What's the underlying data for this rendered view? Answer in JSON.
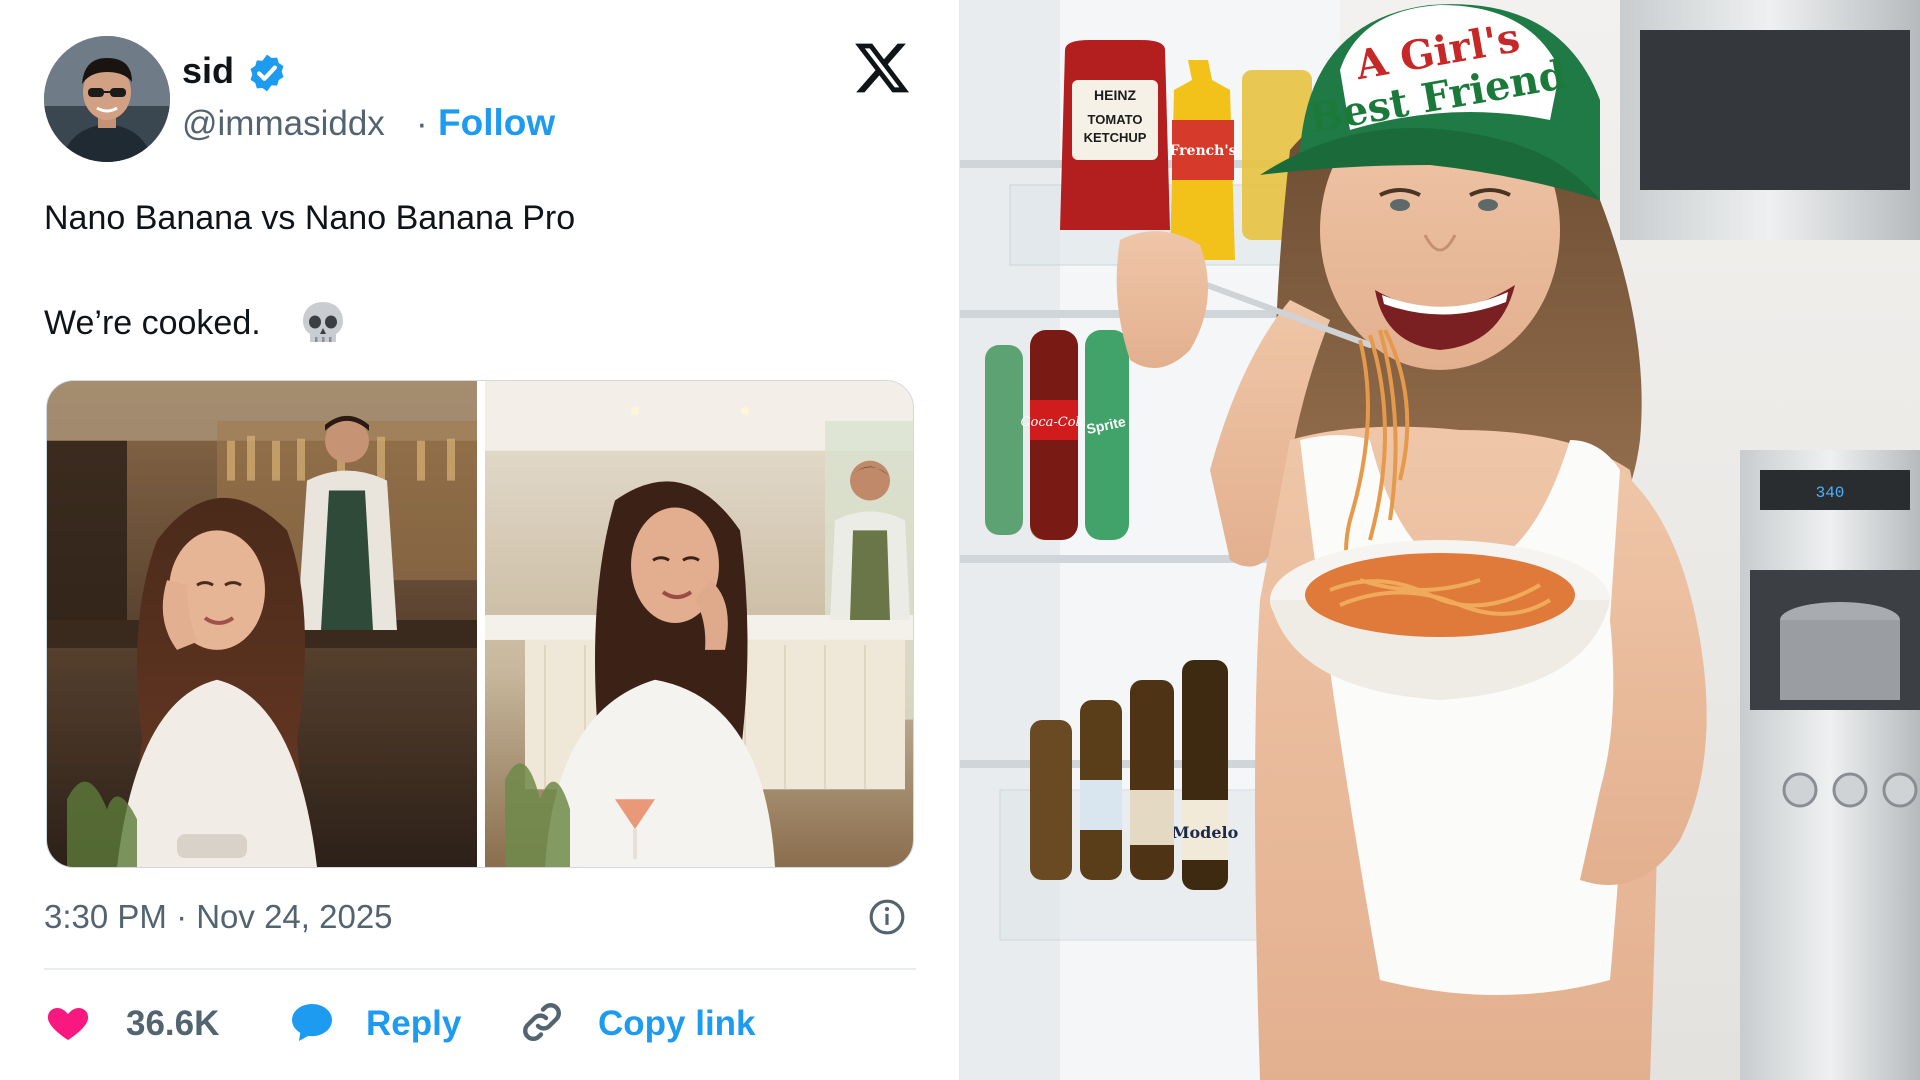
{
  "tweet": {
    "author": {
      "display_name": "sid",
      "handle": "@immasiddx",
      "separator": "·",
      "follow_label": "Follow",
      "verified": true
    },
    "platform_icon": "x-logo-icon",
    "text_line_1": "Nano Banana vs Nano Banana Pro",
    "text_line_2": "We’re cooked.",
    "emoji": "skull-emoji",
    "timestamp": "3:30 PM · Nov 24, 2025",
    "actions": {
      "like_count": "36.6K",
      "reply_label": "Reply",
      "copy_link_label": "Copy link"
    }
  },
  "photo": {
    "cap_line_1": "A Girl's",
    "cap_line_2": "Best Friend",
    "ketchup_label_1": "HEINZ",
    "ketchup_label_2": "TOMATO",
    "ketchup_label_3": "KETCHUP",
    "mustard_label": "French's",
    "cola_label": "Coca-Cola",
    "sprite_label": "Sprite",
    "beer_label": "Modelo"
  },
  "colors": {
    "accent": "#1d9bf0",
    "text_primary": "#0f1419",
    "text_secondary": "#536471",
    "like": "#f91880"
  }
}
